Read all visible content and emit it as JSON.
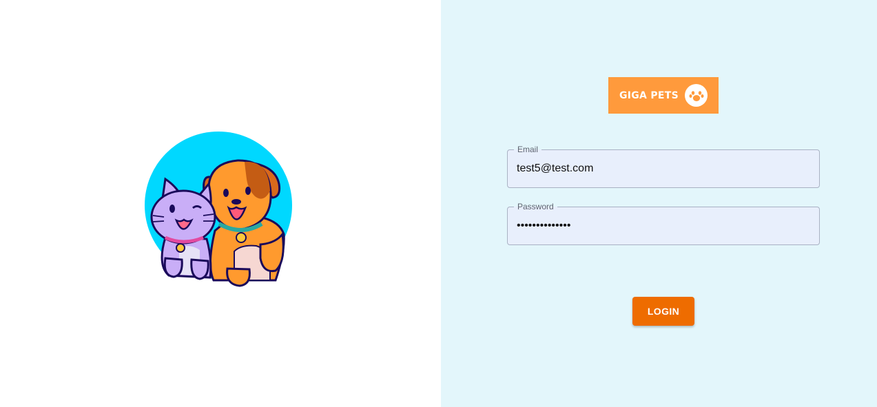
{
  "hero": {
    "illustration_icon": "cat-and-dog-illustration",
    "colors": {
      "circle": "#00d8ff",
      "cat": "#c9aef7",
      "dog": "#ff9a2e",
      "outline": "#1a0a5a"
    }
  },
  "logo": {
    "text": "GIGA PETS",
    "icon": "paw-icon",
    "background": "#ff9a3c"
  },
  "form": {
    "email": {
      "label": "Email",
      "value": "test5@test.com"
    },
    "password": {
      "label": "Password",
      "value": "••••••••••••••"
    },
    "login_label": "LOGIN",
    "login_color": "#ee6c00"
  },
  "theme": {
    "right_panel_bg": "#e3f6fb",
    "field_bg": "#e8effc"
  }
}
